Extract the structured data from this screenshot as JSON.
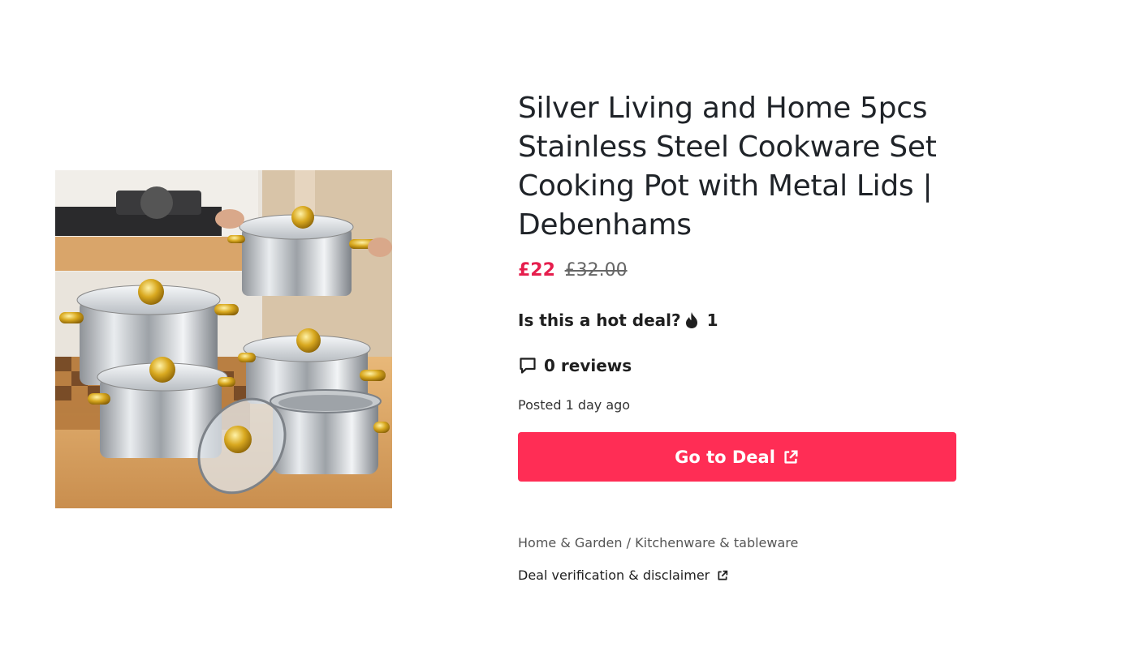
{
  "product": {
    "title": "Silver Living and Home 5pcs Stainless Steel Cookware Set Cooking Pot with Metal Lids | Debenhams",
    "image_alt": "Stainless steel cookware set with gold handles"
  },
  "pricing": {
    "current": "£22",
    "original": "£32.00"
  },
  "hot": {
    "question": "Is this a hot deal?",
    "count": "1",
    "icon": "flame-icon"
  },
  "reviews": {
    "count": "0",
    "label": "reviews",
    "icon": "comment-icon"
  },
  "posted": "Posted 1 day ago",
  "cta": {
    "label": "Go to Deal",
    "icon": "external-link-icon",
    "color": "#ff2d55"
  },
  "breadcrumb": {
    "category": "Home & Garden",
    "separator": "/",
    "subcategory": "Kitchenware & tableware"
  },
  "disclaimer": {
    "label": "Deal verification & disclaimer",
    "icon": "external-link-icon"
  },
  "colors": {
    "accent": "#e61e4d",
    "button": "#ff2d55"
  }
}
